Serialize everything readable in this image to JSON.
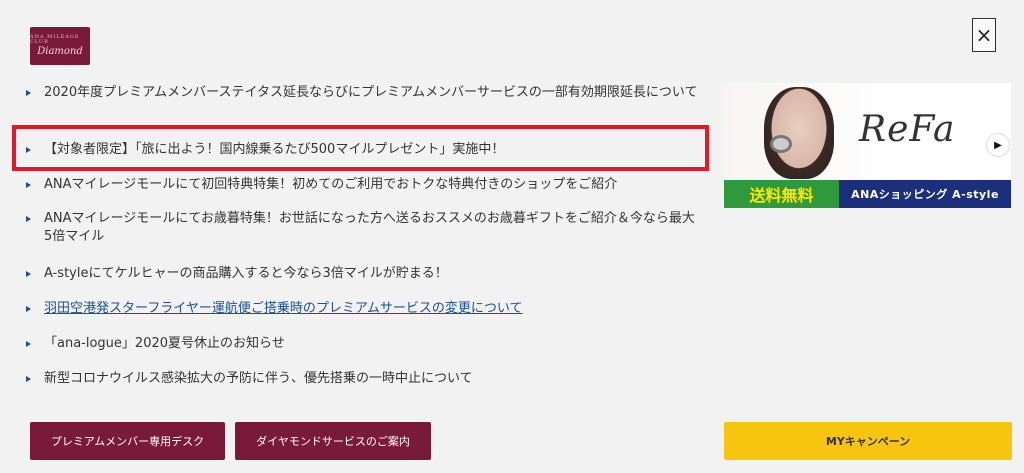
{
  "logo": {
    "small": "ANA MILEAGE CLUB",
    "text": "Diamond"
  },
  "close_label": "×",
  "news": [
    {
      "text": "2020年度プレミアムメンバーステイタス延長ならびにプレミアムメンバーサービスの一部有効期限延長について",
      "link": false
    },
    {
      "text": "【対象者限定】「旅に出よう！国内線乗るたび500マイルプレゼント」実施中！",
      "link": false
    },
    {
      "text": "ANAマイレージモールにて初回特典特集！初めてのご利用でおトクな特典付きのショップをご紹介",
      "link": false
    },
    {
      "text": "ANAマイレージモールにてお歳暮特集！お世話になった方へ送るおススメのお歳暮ギフトをご紹介＆今なら最大5倍マイル",
      "link": false
    },
    {
      "text": "A-styleにてケルヒャーの商品購入すると今なら3倍マイルが貯まる！",
      "link": false
    },
    {
      "text": "羽田空港発スターフライヤー運航便ご搭乗時のプレミアムサービスの変更について",
      "link": true
    },
    {
      "text": "「ana-logue」2020夏号休止のお知らせ",
      "link": false
    },
    {
      "text": "新型コロナウイルス感染拡大の予防に伴う、優先搭乗の一時中止について",
      "link": false
    }
  ],
  "banner": {
    "brand": "ReFa",
    "free_shipping": "送料無料",
    "shop": "ANAショッピング A-style",
    "play": "▶"
  },
  "buttons": {
    "premium_desk": "プレミアムメンバー専用デスク",
    "diamond_service": "ダイヤモンドサービスのご案内",
    "my_campaign": "MYキャンペーン"
  }
}
